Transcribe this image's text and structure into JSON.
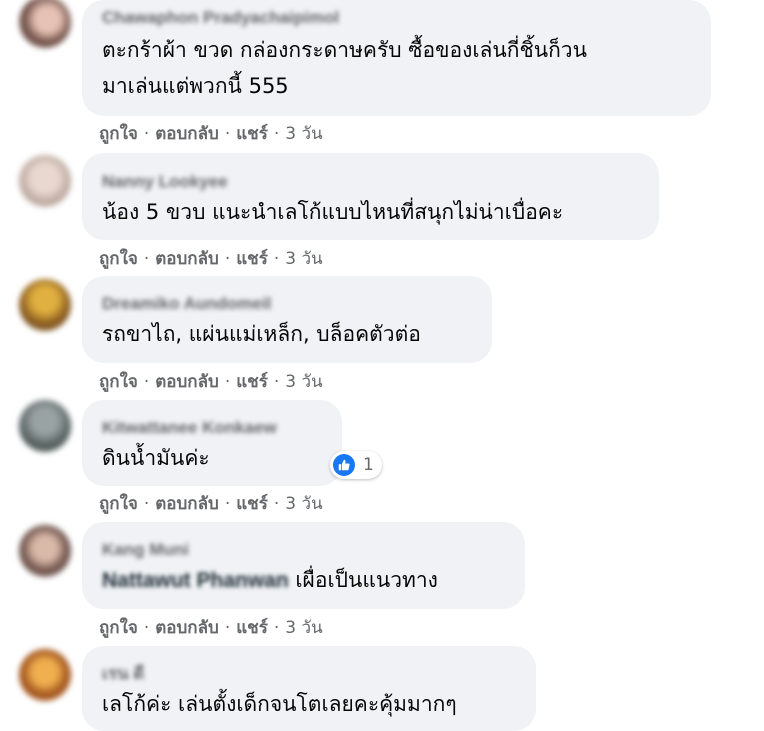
{
  "comments": [
    {
      "author": "Chawaphon Pradyachaipimol",
      "lines": [
        "ตะกร้าผ้า ขวด กล่องกระดาษครับ ซื้อของเล่นกี่ชิ้นก็วน",
        "มาเล่นแต่พวกนี้ 555"
      ],
      "avatar_color": "#a8827a",
      "actions": {
        "like": "ถูกใจ",
        "reply": "ตอบกลับ",
        "share": "แชร์",
        "time": "3 วัน"
      }
    },
    {
      "author": "Nanny Lookyee",
      "lines": [
        "น้อง 5 ขวบ แนะนำเลโก้แบบไหนที่สนุกไม่น่าเบื่อคะ"
      ],
      "avatar_color": "#c7b9b2",
      "actions": {
        "like": "ถูกใจ",
        "reply": "ตอบกลับ",
        "share": "แชร์",
        "time": "3 วัน"
      }
    },
    {
      "author": "Dreamiko Aundomeil",
      "lines": [
        "รถขาไถ, แผ่นแม่เหล็ก, บล็อคตัวต่อ"
      ],
      "avatar_color": "#b48b3a",
      "actions": {
        "like": "ถูกใจ",
        "reply": "ตอบกลับ",
        "share": "แชร์",
        "time": "3 วัน"
      }
    },
    {
      "author": "Kitwattanee Konkaew",
      "lines": [
        "ดินน้ำมันค่ะ"
      ],
      "avatar_color": "#6f7a7a",
      "reaction": {
        "icon": "like-icon",
        "count": "1",
        "color": "#1877f2"
      },
      "actions": {
        "like": "ถูกใจ",
        "reply": "ตอบกลับ",
        "share": "แชร์",
        "time": "3 วัน"
      }
    },
    {
      "author": "Kang Muni",
      "tag_name": "Nattawut Phanwan",
      "text_after_tag": " เผื่อเป็นแนวทาง",
      "avatar_color": "#9a7f74",
      "actions": {
        "like": "ถูกใจ",
        "reply": "ตอบกลับ",
        "share": "แชร์",
        "time": "3 วัน"
      }
    },
    {
      "author": "เรน ดี",
      "lines": [
        "เลโก้ค่ะ เล่นตั้งเด็กจนโตเลยคะคุ้มมากๆ"
      ],
      "avatar_color": "#c5802f"
    }
  ]
}
